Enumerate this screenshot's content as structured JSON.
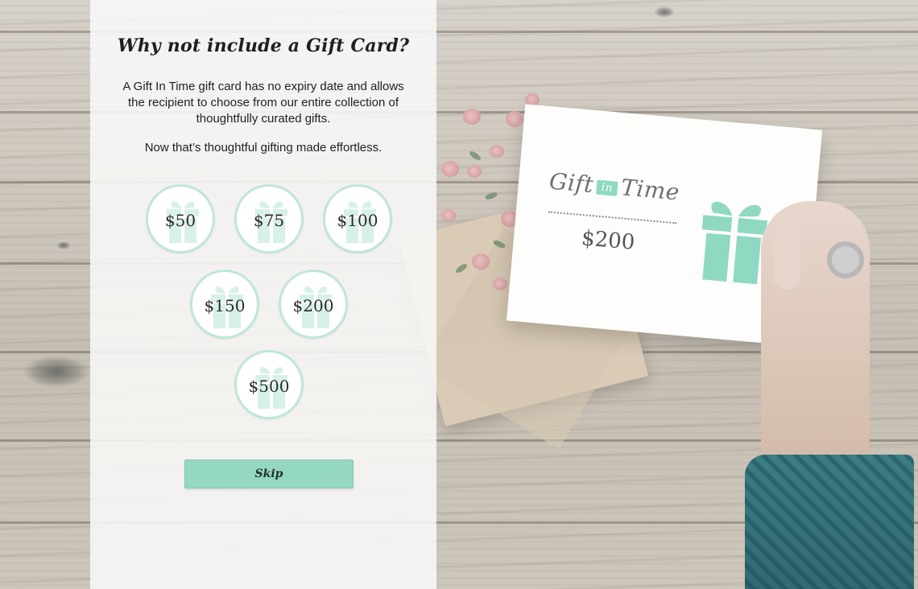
{
  "modal": {
    "title": "Why not include a Gift Card?",
    "description": "A Gift In Time gift card has no expiry date and allows the recipient to choose from our entire collection of thoughtfully curated gifts.",
    "tagline": "Now that’s thoughtful gifting made effortless.",
    "options": [
      {
        "label": "$50"
      },
      {
        "label": "$75"
      },
      {
        "label": "$100"
      },
      {
        "label": "$150"
      },
      {
        "label": "$200"
      },
      {
        "label": "$500"
      }
    ],
    "skip_label": "Skip"
  },
  "background": {
    "card_brand_left": "Gift",
    "card_brand_in": "in",
    "card_brand_right": "Time",
    "card_amount": "$200"
  },
  "colors": {
    "accent": "#94d7c3",
    "accent_soft": "#bfe6d9",
    "panel_bg": "#f8f8f7"
  },
  "icons": {
    "option_icon": "gift-box-icon",
    "card_icon": "gift-box-icon"
  }
}
